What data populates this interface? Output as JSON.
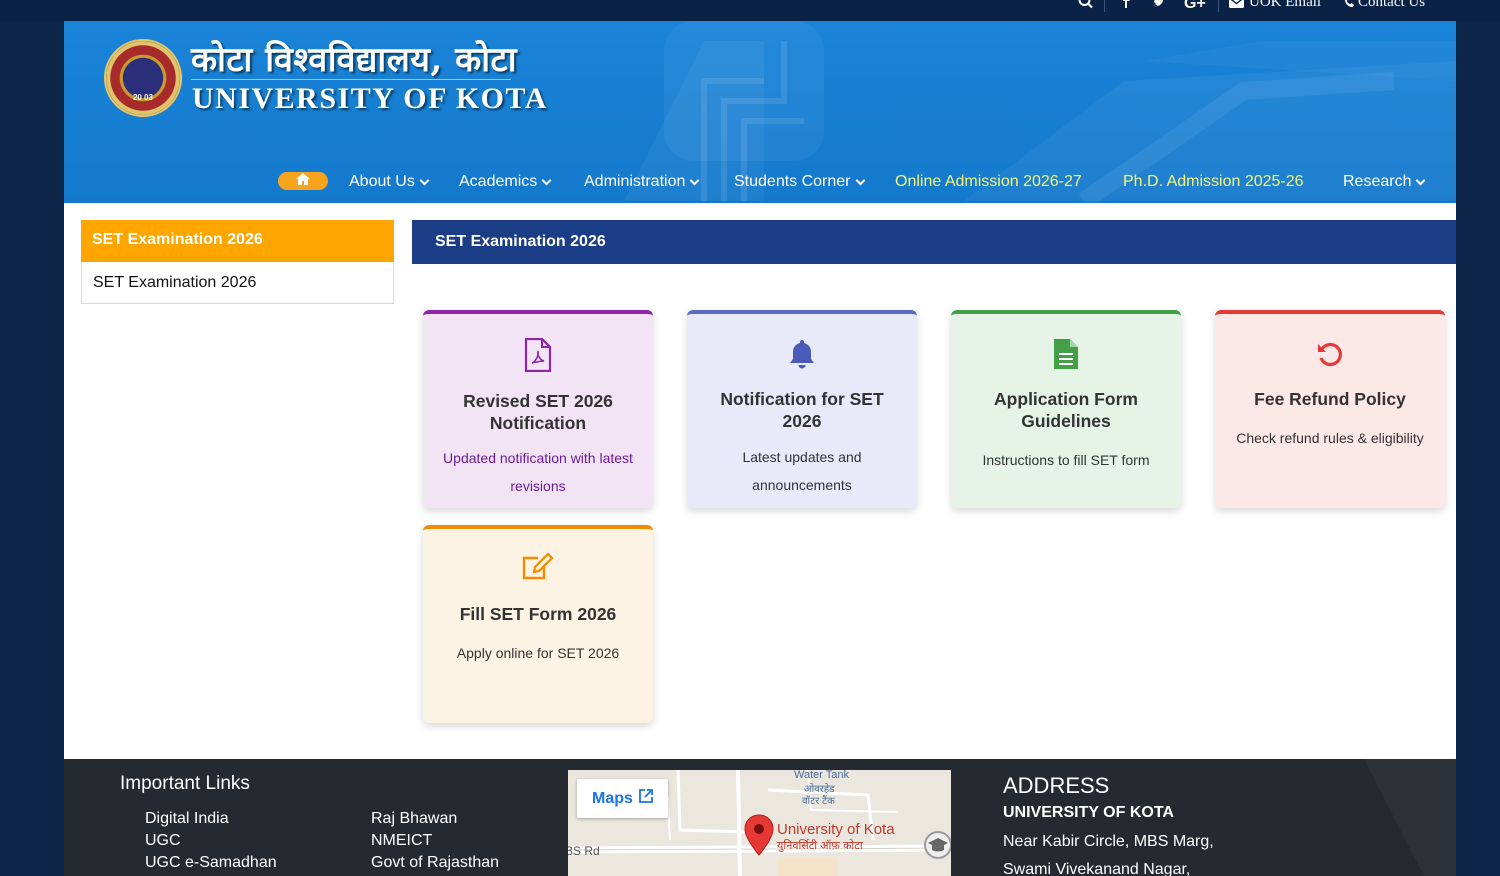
{
  "topbar": {
    "uok_email": "UOK Email",
    "contact_us": "Contact Us"
  },
  "header": {
    "title_hindi": "कोटा विश्वविद्यालय, कोटा",
    "title_english": "UNIVERSITY OF KOTA",
    "logo_year": "20 03"
  },
  "nav": {
    "items": [
      {
        "label": "About Us"
      },
      {
        "label": "Academics"
      },
      {
        "label": "Administration"
      },
      {
        "label": "Students Corner"
      },
      {
        "label": "Online Admission 2026-27"
      },
      {
        "label": "Ph.D. Admission 2025-26"
      },
      {
        "label": "Research"
      }
    ]
  },
  "sidebar": {
    "heading": "SET Examination 2026",
    "items": [
      {
        "label": "SET Examination 2026"
      }
    ]
  },
  "main": {
    "title": "SET Examination 2026",
    "cards": [
      {
        "title": "Revised SET 2026 Notification",
        "desc": "Updated notification with latest revisions",
        "icon": "pdf-file-icon",
        "accent": "#8e24aa"
      },
      {
        "title": "Notification for SET 2026",
        "desc": "Latest updates and announcements",
        "icon": "bell-icon",
        "accent": "#5c6bc0"
      },
      {
        "title": "Application Form Guidelines",
        "desc": "Instructions to fill SET form",
        "icon": "document-icon",
        "accent": "#43a047"
      },
      {
        "title": "Fee Refund Policy",
        "desc": "Check refund rules & eligibility",
        "icon": "refund-icon",
        "accent": "#e53935"
      },
      {
        "title": "Fill SET Form 2026",
        "desc": "Apply online for SET 2026",
        "icon": "edit-icon",
        "accent": "#f08c00"
      }
    ]
  },
  "footer": {
    "important_links_title": "Important Links",
    "links_col1": [
      "Digital India",
      "UGC",
      "UGC e-Samadhan"
    ],
    "links_col2": [
      "Raj Bhawan",
      "NMEICT",
      "Govt of Rajasthan"
    ],
    "map": {
      "button": "Maps",
      "place_en": "University of Kota",
      "place_hi": "युनिवर्सिटी ऑफ़ कोटा",
      "landmark_en": "Water Tank",
      "landmark_hi1": "ओवरहेड",
      "landmark_hi2": "वॉटर टैंक",
      "road": "BS Rd"
    },
    "address_title": "ADDRESS",
    "address_org": "UNIVERSITY OF KOTA",
    "address_line1": "Near Kabir Circle, MBS Marg,",
    "address_line2": "Swami Vivekanand Nagar,"
  },
  "colors": {
    "header_blue": "#1a84d8",
    "nav_highlight": "#f3f57a",
    "sidebar_orange": "#fea500",
    "main_bar_navy": "#1b3d85",
    "footer_dark": "#252a31"
  }
}
